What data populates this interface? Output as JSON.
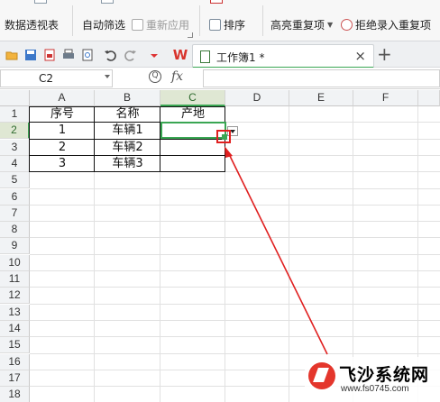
{
  "ribbon": {
    "pivot_label": "数据透视表",
    "autofilter_label": "自动筛选",
    "reapply_label": "重新应用",
    "sort_label": "排序",
    "highlight_dup_label": "高亮重复项",
    "reject_dup_label": "拒绝录入重复项"
  },
  "tabs": {
    "doc_title": "工作簿1 *",
    "close_glyph": "×",
    "add_glyph": "+"
  },
  "formula_bar": {
    "name_box": "C2",
    "fx_label": "fx",
    "formula_value": ""
  },
  "sheet": {
    "columns": [
      "A",
      "B",
      "C",
      "D",
      "E",
      "F"
    ],
    "rows": [
      "1",
      "2",
      "3",
      "4",
      "5",
      "6",
      "7",
      "8",
      "9",
      "10",
      "11",
      "12",
      "13",
      "14",
      "15",
      "16",
      "17",
      "18"
    ],
    "headers": [
      "序号",
      "名称",
      "产地"
    ],
    "data": [
      [
        "1",
        "车辆1",
        ""
      ],
      [
        "2",
        "车辆2",
        ""
      ],
      [
        "3",
        "车辆3",
        ""
      ]
    ],
    "active_cell": "C2"
  },
  "watermark": {
    "title": "飞沙系统网",
    "url": "www.fs0745.com"
  },
  "colors": {
    "accent_green": "#3aa653",
    "annotation_red": "#e02020"
  }
}
